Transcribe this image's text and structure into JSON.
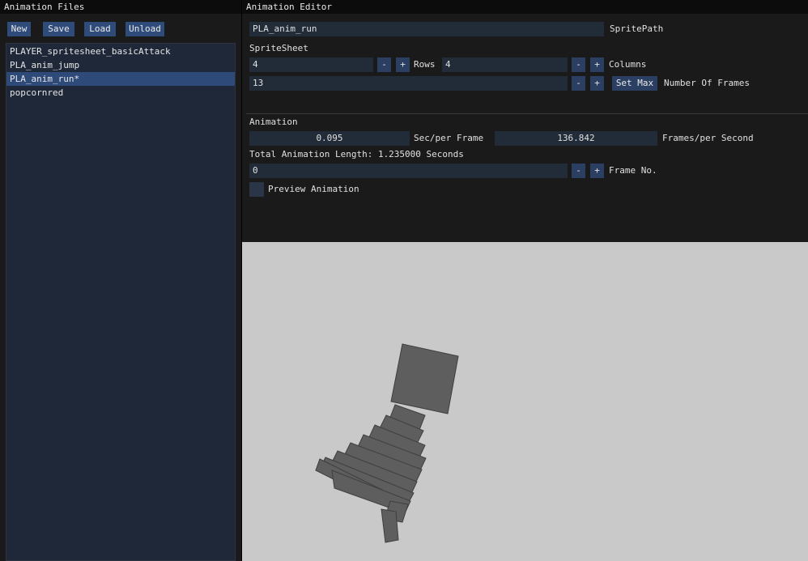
{
  "left_panel": {
    "title": "Animation Files",
    "buttons": {
      "new": "New",
      "save": "Save",
      "load": "Load",
      "unload": "Unload"
    },
    "files": [
      {
        "name": "PLAYER_spritesheet_basicAttack",
        "selected": false
      },
      {
        "name": "PLA_anim_jump",
        "selected": false
      },
      {
        "name": "PLA_anim_run*",
        "selected": true
      },
      {
        "name": "popcornred",
        "selected": false
      }
    ]
  },
  "editor": {
    "title": "Animation Editor",
    "sprite_path": {
      "value": "PLA_anim_run",
      "label": "SpritePath"
    },
    "spritesheet": {
      "header": "SpriteSheet",
      "rows_value": "4",
      "rows_label": "Rows",
      "columns_value": "4",
      "columns_label": "Columns",
      "frames_value": "13",
      "set_max_label": "Set Max",
      "frames_label": "Number Of Frames"
    },
    "animation": {
      "header": "Animation",
      "sec_per_frame_value": "0.095",
      "sec_per_frame_label": "Sec/per Frame",
      "fps_value": "136.842",
      "fps_label": "Frames/per Second",
      "total_length": "Total Animation Length: 1.235000 Seconds",
      "frame_no_value": "0",
      "frame_no_label": "Frame No.",
      "preview_label": "Preview Animation",
      "preview_checked": false
    },
    "stepper": {
      "minus": "-",
      "plus": "+"
    }
  },
  "colors": {
    "button": "#2f4b7a",
    "selected_row": "#2e4a79",
    "preview_background": "#c9c9c9",
    "sprite_fill": "#5e5e5e"
  }
}
